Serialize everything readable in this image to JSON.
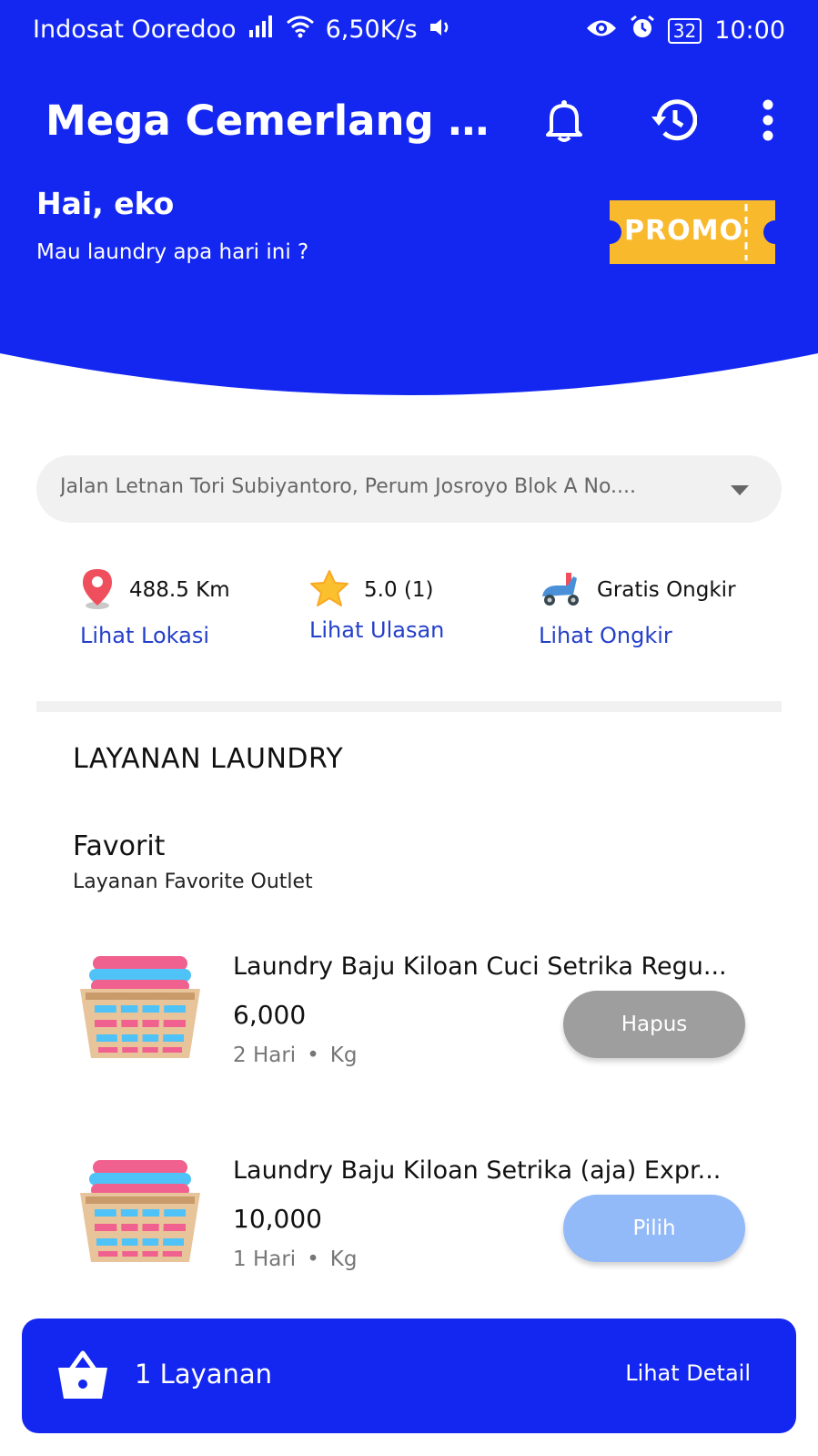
{
  "colors": {
    "primary": "#1327f0",
    "link": "#2440c9",
    "promo": "#f9b92c",
    "btn_remove": "#9e9e9e",
    "btn_select": "#93baf8"
  },
  "status_bar": {
    "carrier": "Indosat Ooredoo",
    "speed": "6,50K/s",
    "battery": "32",
    "time": "10:00"
  },
  "toolbar": {
    "title": "Mega Cemerlang B...",
    "icons": [
      "bell-icon",
      "history-icon",
      "more-vert-icon"
    ]
  },
  "greeting": {
    "hello": "Hai, eko",
    "question": "Mau laundry apa hari ini ?"
  },
  "promo": {
    "label": "PROMO"
  },
  "address": {
    "text": "Jalan Letnan Tori Subiyantoro, Perum Josroyo Blok A No...."
  },
  "info": {
    "distance": {
      "value": "488.5 Km",
      "link": "Lihat Lokasi"
    },
    "rating": {
      "value": "5.0 (1)",
      "link": "Lihat Ulasan"
    },
    "shipping": {
      "value": "Gratis Ongkir",
      "link": "Lihat Ongkir"
    }
  },
  "section": {
    "title": "LAYANAN LAUNDRY",
    "fav_title": "Favorit",
    "fav_sub": "Layanan Favorite Outlet"
  },
  "services": [
    {
      "name": "Laundry Baju Kiloan Cuci Setrika Regu...",
      "price": "6,000",
      "duration": "2 Hari",
      "unit": "Kg",
      "button": "Hapus"
    },
    {
      "name": "Laundry Baju Kiloan Setrika (aja) Expr...",
      "price": "10,000",
      "duration": "1 Hari",
      "unit": "Kg",
      "button": "Pilih"
    }
  ],
  "cart": {
    "count_label": "1 Layanan",
    "detail_label": "Lihat Detail"
  }
}
